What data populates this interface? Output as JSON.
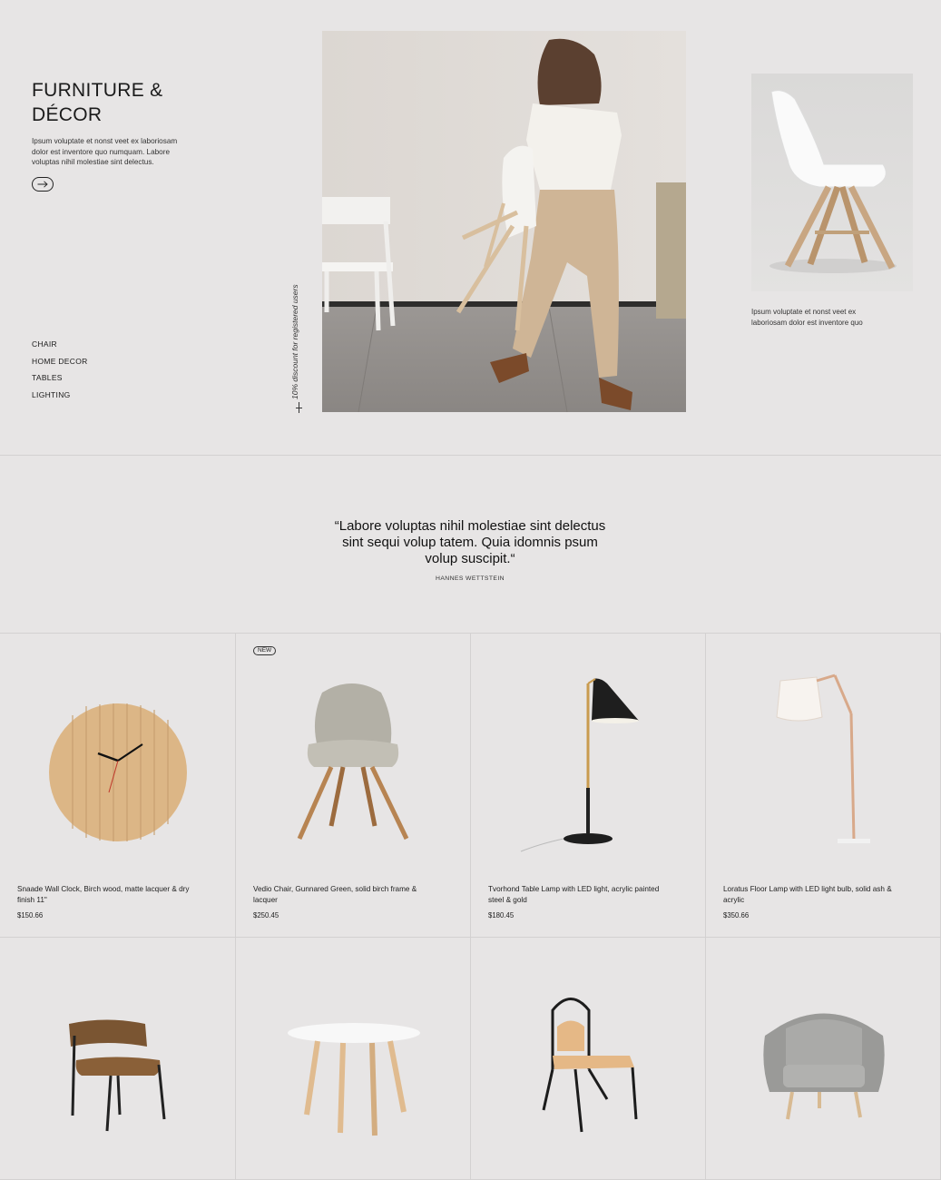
{
  "hero": {
    "title": "FURNITURE & DÉCOR",
    "description": "Ipsum voluptate et nonst veet ex laboriosam dolor est inventore quo numquam. Labore voluptas nihil molestiae sint delectus.",
    "arrow_icon": "arrow-right-icon",
    "categories": [
      "CHAIR",
      "HOME DECOR",
      "TABLES",
      "LIGHTING"
    ],
    "vertical_note": "10% discount for registered users",
    "side_caption": "Ipsum voluptate et nonst veet ex laboriosam dolor est inventore quo"
  },
  "quote": {
    "text": "“Labore voluptas nihil molestiae sint delectus sint sequi volup tatem. Quia idomnis psum volup suscipit.“",
    "author": "HANNES WETTSTEIN"
  },
  "products": [
    {
      "name": "Snaade Wall Clock, Birch wood, matte lacquer & dry finish 11\"",
      "price": "$150.66",
      "badge": ""
    },
    {
      "name": "Vedio Chair, Gunnared Green, solid birch frame & lacquer",
      "price": "$250.45",
      "badge": "NEW"
    },
    {
      "name": "Tvorhond Table Lamp with LED light, acrylic painted steel & gold",
      "price": "$180.45",
      "badge": ""
    },
    {
      "name": "Loratus Floor Lamp with LED light bulb, solid ash & acrylic",
      "price": "$350.66",
      "badge": ""
    },
    {
      "name": "",
      "price": "",
      "badge": ""
    },
    {
      "name": "",
      "price": "",
      "badge": ""
    },
    {
      "name": "",
      "price": "",
      "badge": ""
    },
    {
      "name": "",
      "price": "",
      "badge": ""
    }
  ],
  "colors": {
    "background": "#e7e5e5",
    "text": "#1b1b1b",
    "divider": "#d3d1d1"
  }
}
